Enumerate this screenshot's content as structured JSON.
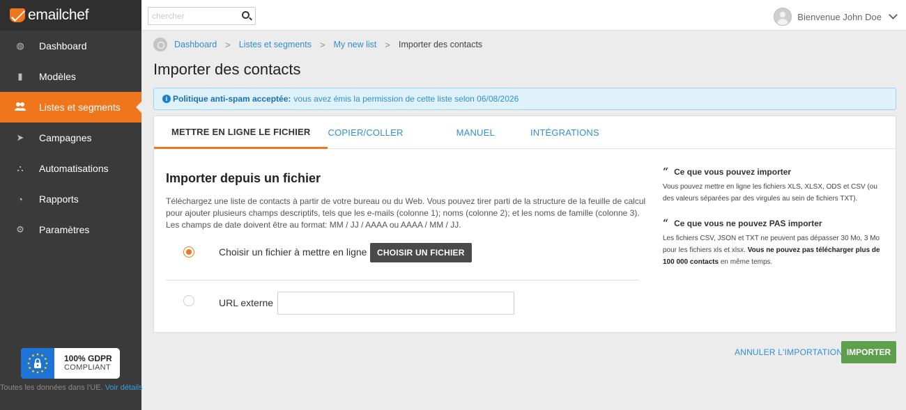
{
  "app": {
    "name": "emailchef",
    "brand_color": "#f0761d"
  },
  "sidebar": {
    "items": [
      {
        "label": "Dashboard",
        "icon": "dashboard-icon",
        "glyph": "◍",
        "active": false
      },
      {
        "label": "Modèles",
        "icon": "document-icon",
        "glyph": "▮",
        "active": false
      },
      {
        "label": "Listes et segments",
        "icon": "users-icon",
        "glyph": "👥",
        "active": true
      },
      {
        "label": "Campagnes",
        "icon": "paper-plane-icon",
        "glyph": "➤",
        "active": false
      },
      {
        "label": "Automatisations",
        "icon": "sitemap-icon",
        "glyph": "⛬",
        "active": false
      },
      {
        "label": "Rapports",
        "icon": "pie-chart-icon",
        "glyph": "◔",
        "active": false
      },
      {
        "label": "Paramètres",
        "icon": "gears-icon",
        "glyph": "⚙",
        "active": false
      }
    ],
    "gdpr": {
      "title": "100% GDPR",
      "subtitle": "COMPLIANT",
      "footer": "Toutes les données dans l'UE.",
      "footer_link": "Voir détails"
    }
  },
  "topbar": {
    "search_placeholder": "chercher",
    "user_greeting": "Bienvenue John Doe"
  },
  "breadcrumb": {
    "items": [
      "Dashboard",
      "Listes et segments",
      "My new list"
    ],
    "current": "Importer des contacts",
    "separator": ">"
  },
  "page": {
    "title": "Importer des contacts",
    "alert": {
      "bold": "Politique anti-spam acceptée:",
      "text": "vous avez émis la permission de cette liste selon 06/08/2026"
    },
    "tabs": [
      {
        "label": "METTRE EN LIGNE LE FICHIER",
        "active": true
      },
      {
        "label": "COPIER/COLLER",
        "active": false
      },
      {
        "label": "MANUEL",
        "active": false
      },
      {
        "label": "INTÉGRATIONS",
        "active": false
      }
    ],
    "section_title": "Importer depuis un fichier",
    "description": "Téléchargez une liste de contacts à partir de votre bureau ou du Web. Vous pouvez tirer parti de la structure de la feuille de calcul pour ajouter plusieurs champs descriptifs, tels que les e-mails (colonne 1); noms (colonne 2); et les noms de famille (colonne 3). Les champs de date doivent être au format: MM / JJ / AAAA ou AAAA / MM / JJ.",
    "option_file_label": "Choisir un fichier à mettre en ligne",
    "choose_file_button": "CHOISIR UN FICHIER",
    "option_url_label": "URL externe",
    "url_value": "",
    "aside": {
      "can_title": "Ce que vous pouvez importer",
      "can_text": "Vous pouvez mettre en ligne les fichiers XLS, XLSX, ODS et CSV (ou des valeurs séparées par des virgules au sein de fichiers TXT).",
      "cannot_title": "Ce que vous ne pouvez PAS importer",
      "cannot_text": "Les fichiers CSV, JSON et TXT ne peuvent pas dépasser 30 Mo, 3 Mo pour les fichiers xls et xlsx.",
      "cannot_bold": "Vous ne pouvez pas télécharger plus de 100 000 contacts",
      "cannot_tail": "en même temps."
    },
    "cancel_label": "ANNULER L'IMPORTATION",
    "import_label": "IMPORTER"
  }
}
